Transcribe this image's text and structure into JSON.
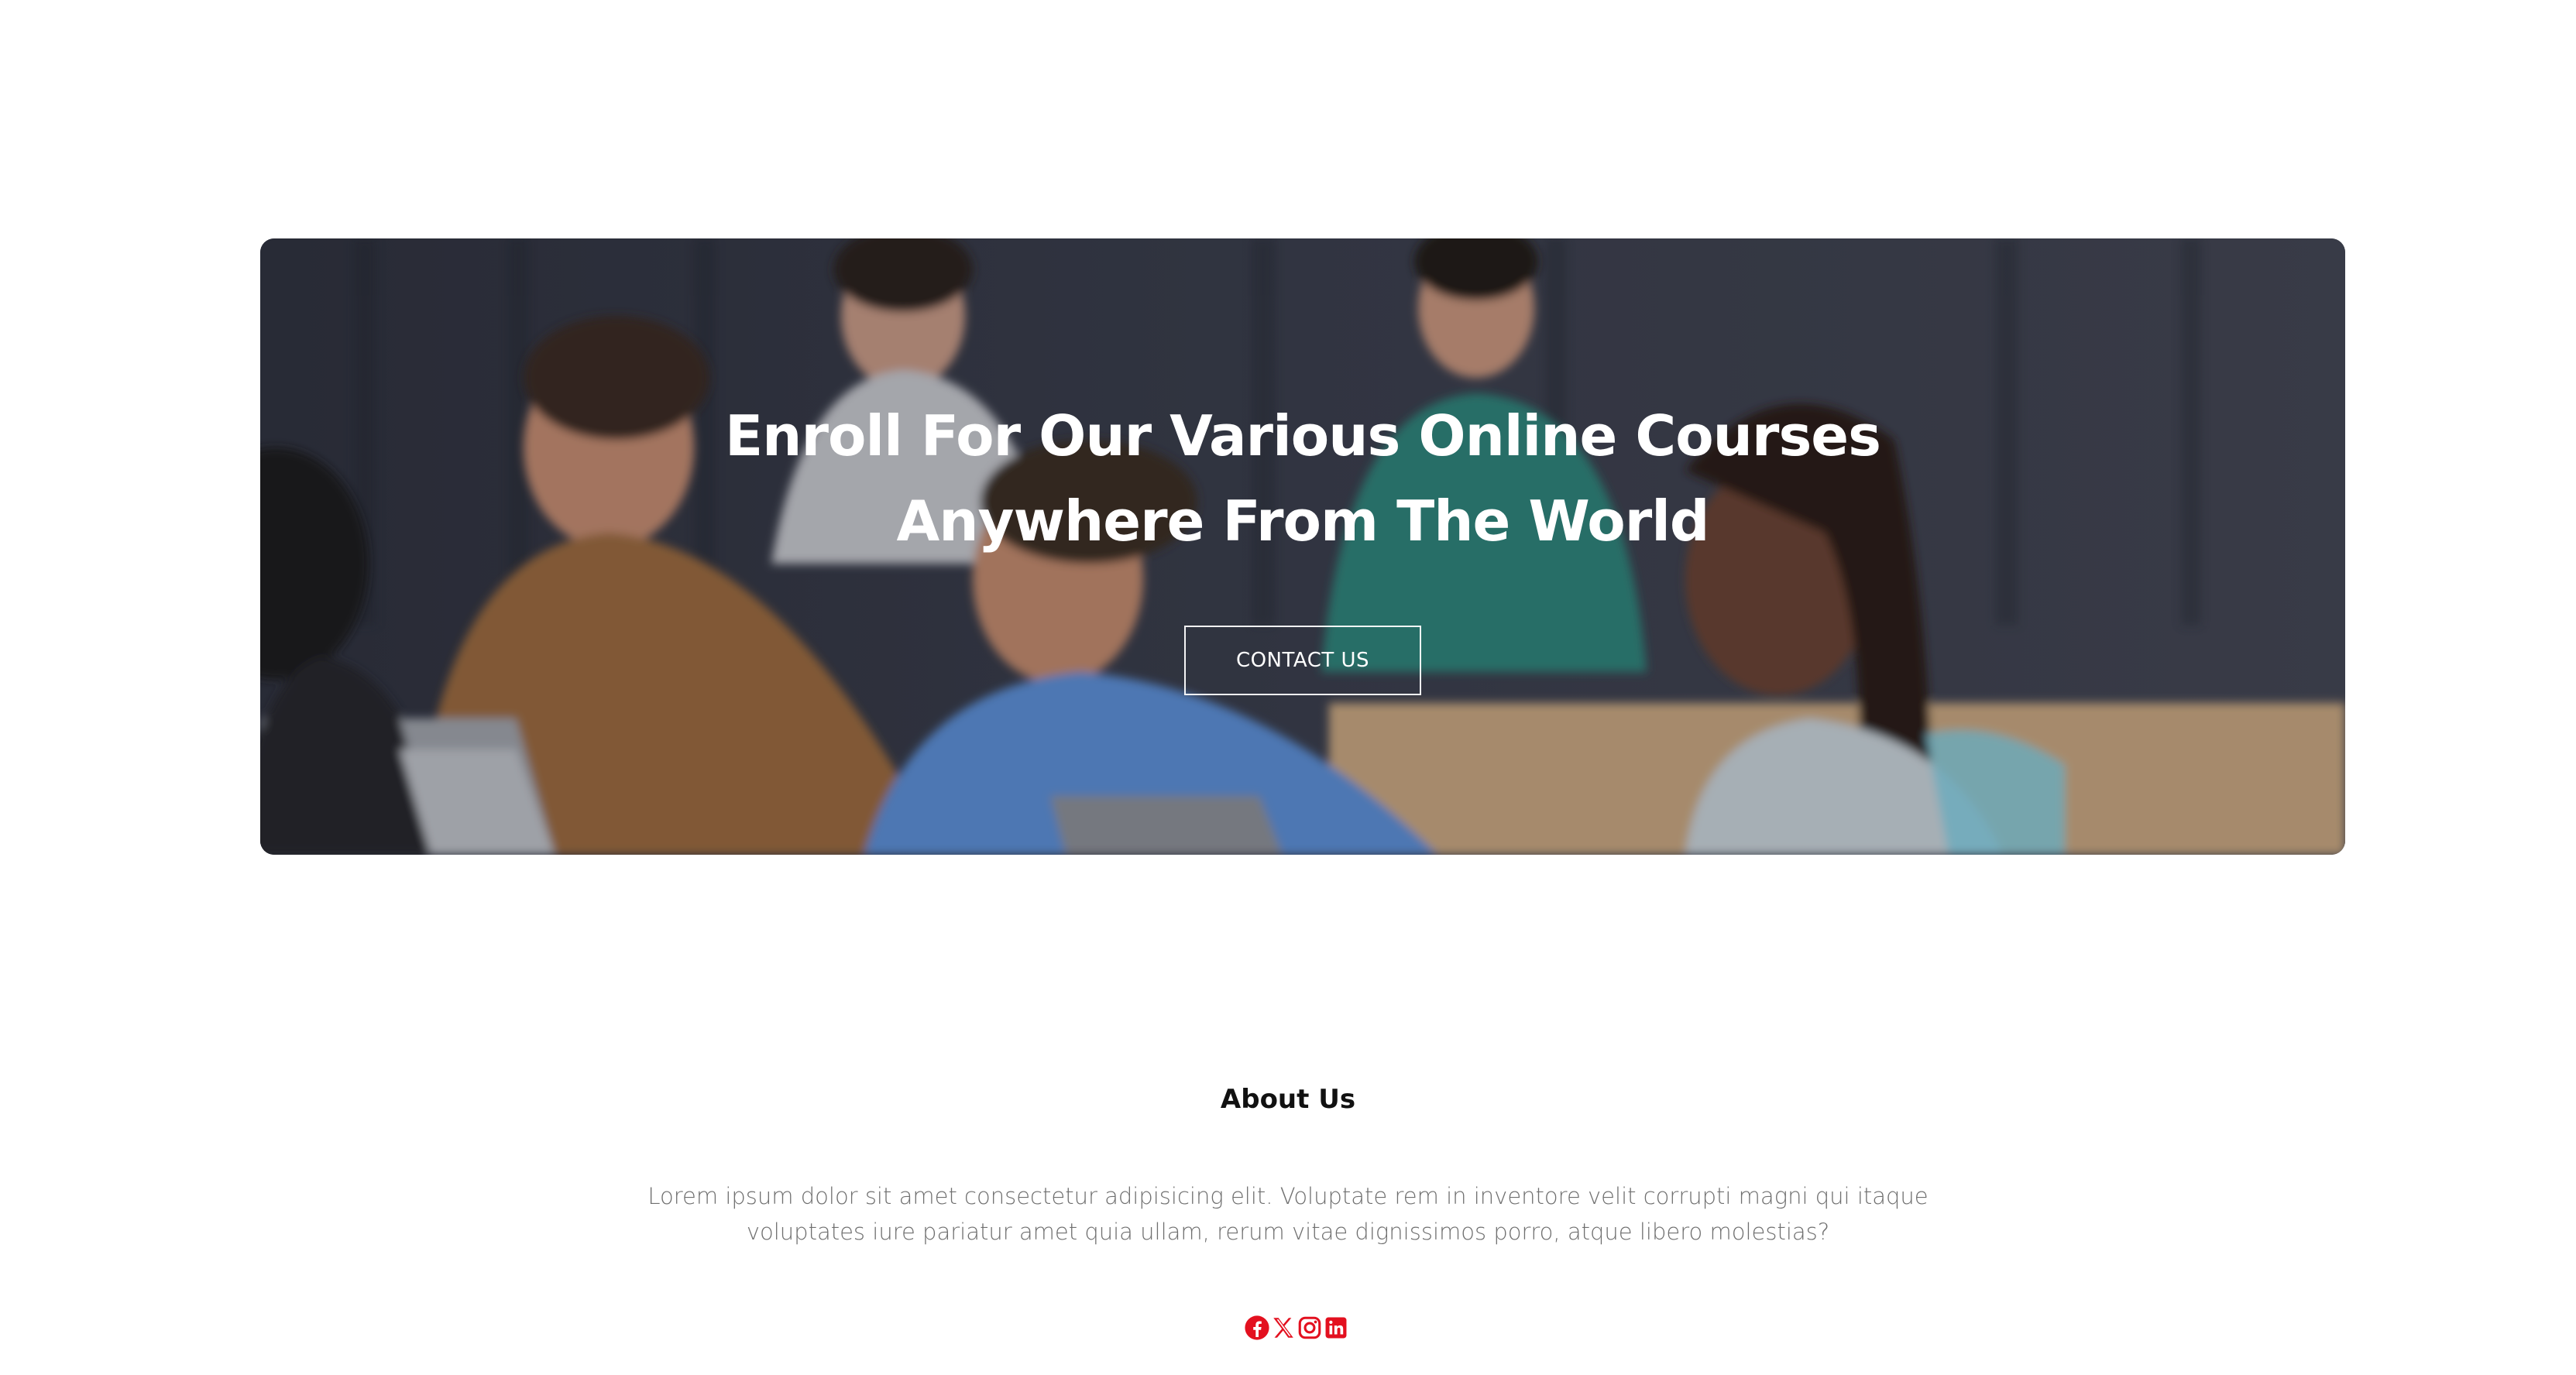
{
  "hero": {
    "title_line1": "Enroll For Our Various Online Courses",
    "title_line2": "Anywhere From The World",
    "cta_label": "CONTACT US"
  },
  "about": {
    "title": "About Us",
    "text": "Lorem ipsum dolor sit amet consectetur adipisicing elit. Voluptate rem in inventore velit corrupti magni qui itaque voluptates iure pariatur amet quia ullam, rerum vitae dignissimos porro, atque libero molestias?"
  },
  "social": {
    "icons": [
      "facebook-icon",
      "x-twitter-icon",
      "instagram-icon",
      "linkedin-icon"
    ],
    "color": "#e3101f"
  },
  "colors": {
    "background": "#ffffff",
    "hero_text": "#ffffff",
    "about_title": "#111111",
    "about_text": "#6f6f6f"
  }
}
